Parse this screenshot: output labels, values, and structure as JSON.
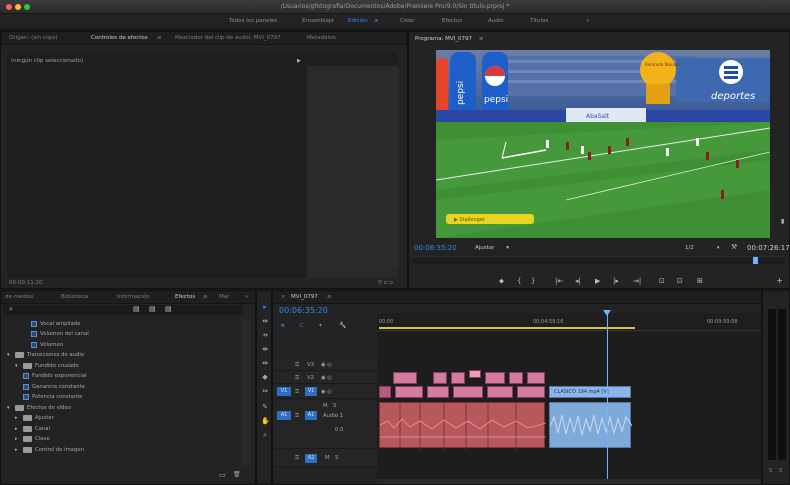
{
  "window": {
    "title": "/Usuarios/gfotografia/Documentos/Adobe/Premiere Pro/9.0/Sin título.prproj *"
  },
  "workspaces": [
    "Todos los paneles",
    "Ensamblaje",
    "Edición",
    "Color",
    "Efectos",
    "Audio",
    "Títulos",
    "»"
  ],
  "workspace_active": "Edición",
  "source_panel": {
    "tabs": [
      "Origen: (sin clips)",
      "Controles de efectos",
      "Mezclador del clip de audio: MVI_0797",
      "Metadatos"
    ],
    "active_tab": "Controles de efectos",
    "menu_glyph": "≡",
    "no_clip_text": "(ningún clip seleccionado)",
    "play_glyph": "▶",
    "timecode": "00:00:11:20",
    "extra": "⚲  ⊏⊐"
  },
  "program": {
    "tab_label": "Programa: MVI_0797",
    "menu_glyph": "≡",
    "timecode": "00:06:35:20",
    "fit_label": "Ajustar",
    "fit_caret": "▾",
    "resolution": "1/2",
    "duration": "00:07:26:17",
    "wrench_glyph": "🔧",
    "transport": [
      "⬥",
      "{",
      "}",
      "|⇤",
      "◂|",
      "▶",
      "|▸",
      "⇥|",
      "⊡",
      "⊡",
      "⊞"
    ],
    "add_glyph": "+",
    "video": {
      "brand_left": "pepsi",
      "brand_right": "deportes",
      "banner_text": "Rentruda Novanar",
      "sponsor_text": "AbaSalt",
      "yellow_banner": "▶ Stallenger"
    }
  },
  "effects_panel": {
    "tabs": [
      "de medios",
      "Biblioteca",
      "Información",
      "Efectos",
      "Mar",
      "»"
    ],
    "active_tab": "Efectos",
    "search_glyph": "⌕",
    "filter_icons": [
      "▤",
      "▤",
      "▤"
    ],
    "items": [
      {
        "indent": 3,
        "kind": "fx",
        "label": "Vocal ampliado"
      },
      {
        "indent": 3,
        "kind": "fx",
        "label": "Volumen del canal"
      },
      {
        "indent": 3,
        "kind": "fx",
        "label": "Volumen"
      },
      {
        "indent": 0,
        "kind": "folder-open",
        "label": "Transiciones de audio"
      },
      {
        "indent": 1,
        "kind": "folder-open",
        "label": "Fundido cruzado"
      },
      {
        "indent": 2,
        "kind": "tr",
        "label": "Fundido exponencial"
      },
      {
        "indent": 2,
        "kind": "tr",
        "label": "Ganancia constante"
      },
      {
        "indent": 2,
        "kind": "tr",
        "label": "Potencia constante"
      },
      {
        "indent": 0,
        "kind": "folder-open",
        "label": "Efectos de vídeo"
      },
      {
        "indent": 1,
        "kind": "folder",
        "label": "Ajustar"
      },
      {
        "indent": 1,
        "kind": "folder",
        "label": "Canal"
      },
      {
        "indent": 1,
        "kind": "folder",
        "label": "Clave"
      },
      {
        "indent": 1,
        "kind": "folder",
        "label": "Control de imagen"
      }
    ],
    "bottom_icons": [
      "▭",
      "🗑"
    ]
  },
  "tools": [
    "▸",
    "⇹",
    "⇸",
    "⇼",
    "⇹",
    "◆",
    "⇔",
    "✎",
    "✋",
    "⌕"
  ],
  "timeline": {
    "tab_label": "MVI_0797",
    "close_glyph": "×",
    "menu_glyph": "≡",
    "timecode": "00:06:35:20",
    "ruler": [
      "00:00",
      "00:04:59:16",
      "00:09:59:08"
    ],
    "tracks": [
      {
        "name": "V3",
        "type": "video"
      },
      {
        "name": "V2",
        "type": "video"
      },
      {
        "name": "V1",
        "type": "video"
      },
      {
        "name": "A1",
        "type": "audio",
        "label": "Audio 1"
      },
      {
        "name": "A2",
        "type": "audio"
      }
    ],
    "v1_clip": "CLASICO 194.mp4 [V]",
    "a1_value": "0.0",
    "m_label": "M",
    "s_label": "S"
  },
  "meters": {
    "labels": [
      "S",
      "S"
    ]
  },
  "colors": {
    "accent_blue": "#2d8ceb",
    "video_clip": "#d37c9f",
    "audio_clip": "#2e9b70",
    "selected_clip": "#8cb6e8",
    "playhead": "#6fb3ff"
  }
}
